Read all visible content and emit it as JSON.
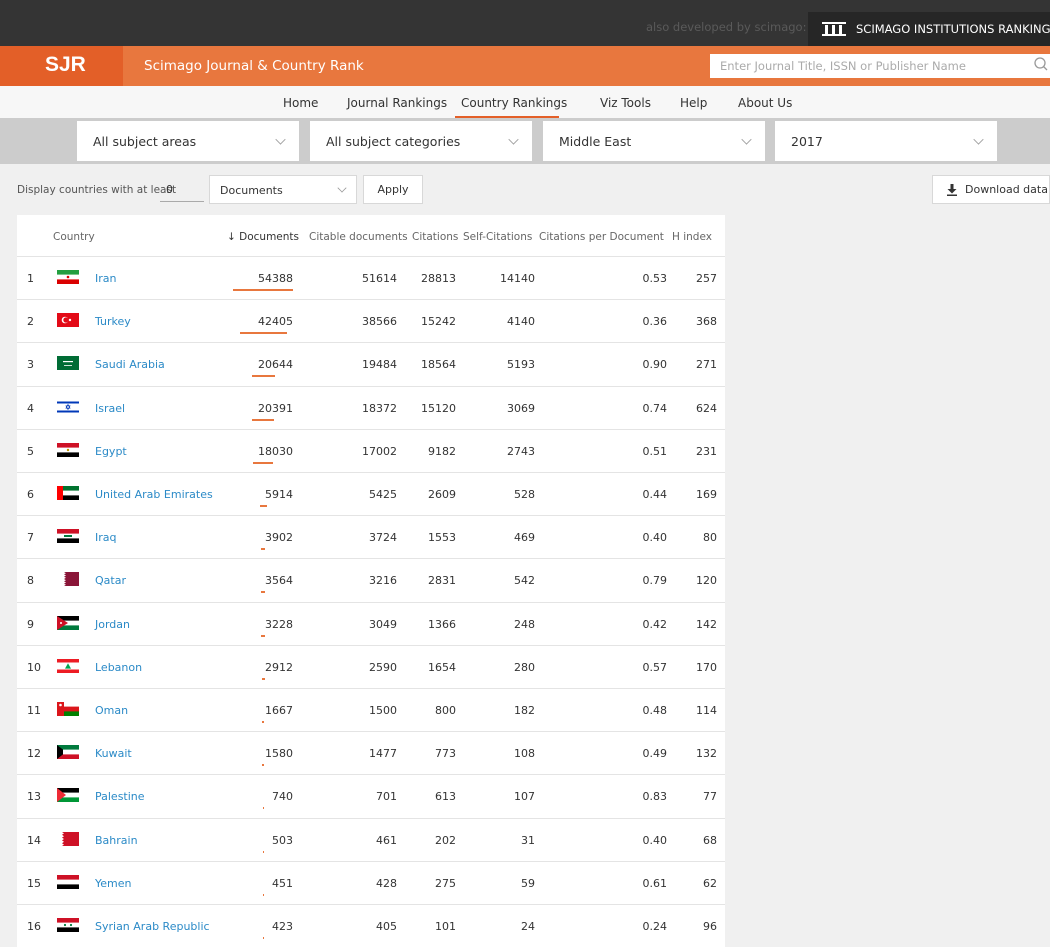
{
  "topbar": {
    "also_text": "also developed by scimago:",
    "institutions_label": "SCIMAGO INSTITUTIONS RANKINGS"
  },
  "header": {
    "logo": "SJR",
    "title": "Scimago Journal & Country Rank",
    "search_placeholder": "Enter Journal Title, ISSN or Publisher Name"
  },
  "nav": {
    "items": [
      "Home",
      "Journal Rankings",
      "Country Rankings",
      "Viz Tools",
      "Help",
      "About Us"
    ],
    "active": "Country Rankings"
  },
  "filters": {
    "subject_area": "All subject areas",
    "subject_category": "All subject categories",
    "region": "Middle East",
    "year": "2017"
  },
  "options": {
    "label": "Display countries with at least",
    "count": "0",
    "metric": "Documents",
    "apply": "Apply",
    "download": "Download data"
  },
  "table": {
    "columns": {
      "country": "Country",
      "documents": "Documents",
      "citable": "Citable documents",
      "citations": "Citations",
      "self_citations": "Self-Citations",
      "cpd": "Citations per Document",
      "h_index": "H index"
    },
    "sort_icon": "arrow-down-icon",
    "accent_color": "#e8773e",
    "link_color": "#2b8ac7",
    "rows": [
      {
        "rank": "1",
        "country": "Iran",
        "flag": "iran-flag-icon",
        "documents": "54388",
        "citable": "51614",
        "citations": "28813",
        "self_citations": "14140",
        "cpd": "0.53",
        "h_index": "257"
      },
      {
        "rank": "2",
        "country": "Turkey",
        "flag": "turkey-flag-icon",
        "documents": "42405",
        "citable": "38566",
        "citations": "15242",
        "self_citations": "4140",
        "cpd": "0.36",
        "h_index": "368"
      },
      {
        "rank": "3",
        "country": "Saudi Arabia",
        "flag": "saudi-arabia-flag-icon",
        "documents": "20644",
        "citable": "19484",
        "citations": "18564",
        "self_citations": "5193",
        "cpd": "0.90",
        "h_index": "271"
      },
      {
        "rank": "4",
        "country": "Israel",
        "flag": "israel-flag-icon",
        "documents": "20391",
        "citable": "18372",
        "citations": "15120",
        "self_citations": "3069",
        "cpd": "0.74",
        "h_index": "624"
      },
      {
        "rank": "5",
        "country": "Egypt",
        "flag": "egypt-flag-icon",
        "documents": "18030",
        "citable": "17002",
        "citations": "9182",
        "self_citations": "2743",
        "cpd": "0.51",
        "h_index": "231"
      },
      {
        "rank": "6",
        "country": "United Arab Emirates",
        "flag": "uae-flag-icon",
        "documents": "5914",
        "citable": "5425",
        "citations": "2609",
        "self_citations": "528",
        "cpd": "0.44",
        "h_index": "169"
      },
      {
        "rank": "7",
        "country": "Iraq",
        "flag": "iraq-flag-icon",
        "documents": "3902",
        "citable": "3724",
        "citations": "1553",
        "self_citations": "469",
        "cpd": "0.40",
        "h_index": "80"
      },
      {
        "rank": "8",
        "country": "Qatar",
        "flag": "qatar-flag-icon",
        "documents": "3564",
        "citable": "3216",
        "citations": "2831",
        "self_citations": "542",
        "cpd": "0.79",
        "h_index": "120"
      },
      {
        "rank": "9",
        "country": "Jordan",
        "flag": "jordan-flag-icon",
        "documents": "3228",
        "citable": "3049",
        "citations": "1366",
        "self_citations": "248",
        "cpd": "0.42",
        "h_index": "142"
      },
      {
        "rank": "10",
        "country": "Lebanon",
        "flag": "lebanon-flag-icon",
        "documents": "2912",
        "citable": "2590",
        "citations": "1654",
        "self_citations": "280",
        "cpd": "0.57",
        "h_index": "170"
      },
      {
        "rank": "11",
        "country": "Oman",
        "flag": "oman-flag-icon",
        "documents": "1667",
        "citable": "1500",
        "citations": "800",
        "self_citations": "182",
        "cpd": "0.48",
        "h_index": "114"
      },
      {
        "rank": "12",
        "country": "Kuwait",
        "flag": "kuwait-flag-icon",
        "documents": "1580",
        "citable": "1477",
        "citations": "773",
        "self_citations": "108",
        "cpd": "0.49",
        "h_index": "132"
      },
      {
        "rank": "13",
        "country": "Palestine",
        "flag": "palestine-flag-icon",
        "documents": "740",
        "citable": "701",
        "citations": "613",
        "self_citations": "107",
        "cpd": "0.83",
        "h_index": "77"
      },
      {
        "rank": "14",
        "country": "Bahrain",
        "flag": "bahrain-flag-icon",
        "documents": "503",
        "citable": "461",
        "citations": "202",
        "self_citations": "31",
        "cpd": "0.40",
        "h_index": "68"
      },
      {
        "rank": "15",
        "country": "Yemen",
        "flag": "yemen-flag-icon",
        "documents": "451",
        "citable": "428",
        "citations": "275",
        "self_citations": "59",
        "cpd": "0.61",
        "h_index": "62"
      },
      {
        "rank": "16",
        "country": "Syrian Arab Republic",
        "flag": "syria-flag-icon",
        "documents": "423",
        "citable": "405",
        "citations": "101",
        "self_citations": "24",
        "cpd": "0.24",
        "h_index": "96"
      }
    ]
  }
}
